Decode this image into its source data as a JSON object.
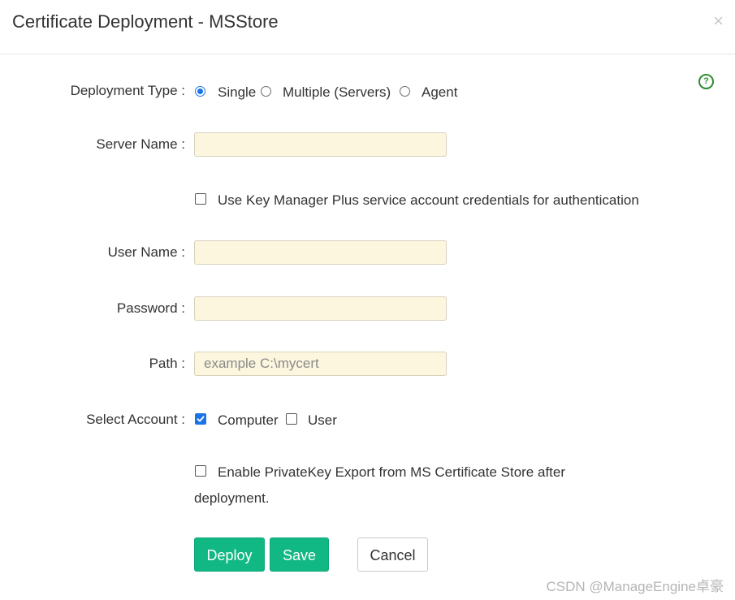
{
  "dialog": {
    "title": "Certificate Deployment - MSStore",
    "close_symbol": "×",
    "help_symbol": "?"
  },
  "form": {
    "deployment_type": {
      "label": "Deployment Type :",
      "options": [
        "Single",
        "Multiple (Servers)",
        "Agent"
      ],
      "selected": "Single"
    },
    "server_name": {
      "label": "Server Name :",
      "value": "",
      "placeholder": ""
    },
    "use_service_account": {
      "label": "Use Key Manager Plus service account credentials for authentication",
      "checked": false
    },
    "user_name": {
      "label": "User Name :",
      "value": "",
      "placeholder": ""
    },
    "password": {
      "label": "Password :",
      "value": "",
      "placeholder": ""
    },
    "path": {
      "label": "Path :",
      "value": "",
      "placeholder": "example C:\\mycert"
    },
    "select_account": {
      "label": "Select Account :",
      "options": [
        "Computer",
        "User"
      ],
      "checked": {
        "Computer": true,
        "User": false
      }
    },
    "private_key_export": {
      "label_line1": "Enable PrivateKey Export from MS Certificate Store after",
      "label_line2": "deployment.",
      "checked": false
    }
  },
  "buttons": {
    "deploy": "Deploy",
    "save": "Save",
    "cancel": "Cancel"
  },
  "watermark": "CSDN @ManageEngine卓豪",
  "colors": {
    "primary_button": "#12b884",
    "field_background": "#fcf6df",
    "help_icon": "#2e8b2e",
    "control_accent": "#1a73e8"
  },
  "icons": {
    "close": "close-icon",
    "help": "help-circle-icon",
    "check": "checkmark-icon"
  }
}
